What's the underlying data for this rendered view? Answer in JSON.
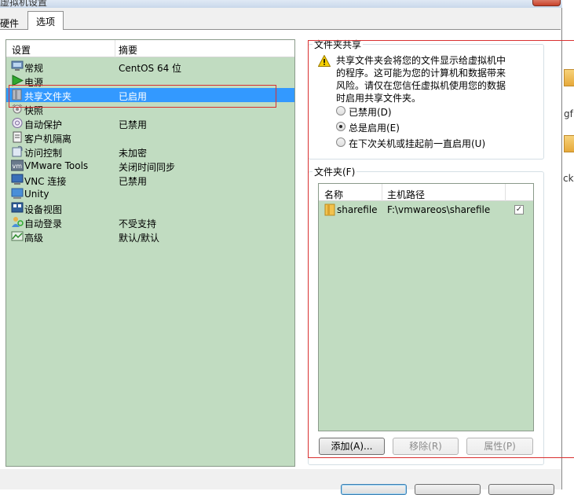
{
  "window": {
    "title_fragment": "虚拟机设置"
  },
  "tabs": [
    {
      "label": "硬件"
    },
    {
      "label": "选项"
    }
  ],
  "settings": {
    "header_setting": "设置",
    "header_summary": "摘要",
    "items": [
      {
        "name": "常规",
        "summary": "CentOS 64 位",
        "icon": "computer-icon"
      },
      {
        "name": "电源",
        "summary": "",
        "icon": "play-icon"
      },
      {
        "name": "共享文件夹",
        "summary": "已启用",
        "icon": "shared-folder-icon",
        "selected": true
      },
      {
        "name": "快照",
        "summary": "",
        "icon": "snapshot-icon"
      },
      {
        "name": "自动保护",
        "summary": "已禁用",
        "icon": "autoprotect-icon"
      },
      {
        "name": "客户机隔离",
        "summary": "",
        "icon": "isolation-icon"
      },
      {
        "name": "访问控制",
        "summary": "未加密",
        "icon": "access-control-icon"
      },
      {
        "name": "VMware Tools",
        "summary": "关闭时间同步",
        "icon": "vmware-tools-icon"
      },
      {
        "name": "VNC 连接",
        "summary": "已禁用",
        "icon": "vnc-icon"
      },
      {
        "name": "Unity",
        "summary": "",
        "icon": "unity-icon"
      },
      {
        "name": "设备视图",
        "summary": "",
        "icon": "device-view-icon"
      },
      {
        "name": "自动登录",
        "summary": "不受支持",
        "icon": "autologin-icon"
      },
      {
        "name": "高级",
        "summary": "默认/默认",
        "icon": "advanced-icon"
      }
    ]
  },
  "folder_sharing": {
    "title": "文件夹共享",
    "warning_lines": [
      "共享文件夹会将您的文件显示给虚拟机中",
      "的程序。这可能为您的计算机和数据带来",
      "风险。请仅在您信任虚拟机使用您的数据",
      "时启用共享文件夹。"
    ],
    "options": [
      {
        "label": "已禁用(D)",
        "checked": false
      },
      {
        "label": "总是启用(E)",
        "checked": true
      },
      {
        "label": "在下次关机或挂起前一直启用(U)",
        "checked": false
      }
    ]
  },
  "folders": {
    "title": "文件夹(F)",
    "header_name": "名称",
    "header_path": "主机路径",
    "rows": [
      {
        "name": "sharefile",
        "path": "F:\\vmwareos\\sharefile",
        "enabled": true
      }
    ],
    "add_label": "添加(A)...",
    "remove_label": "移除(R)",
    "properties_label": "属性(P)"
  },
  "outside_fragments": [
    "gf",
    "ck"
  ],
  "colors": {
    "list_bg": "#c1dcc1",
    "selection": "#3399ff",
    "annotation_red": "#d93030"
  }
}
